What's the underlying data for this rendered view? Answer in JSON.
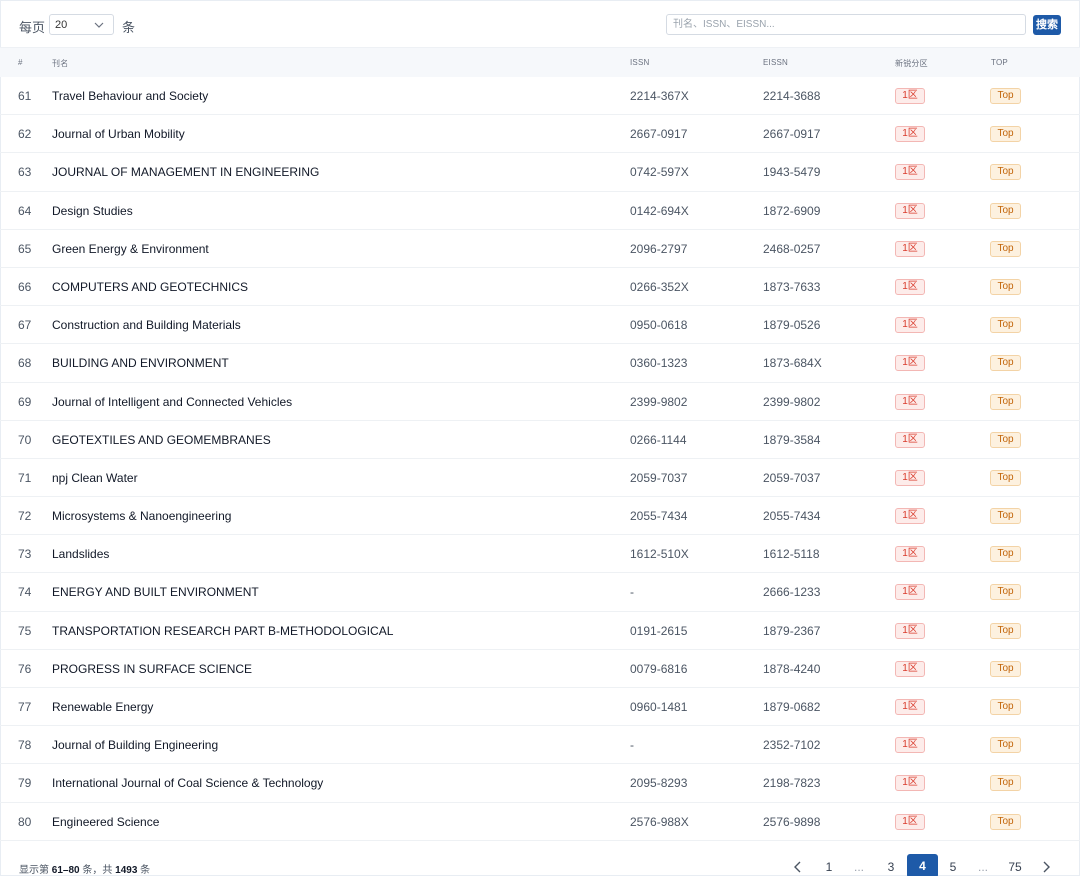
{
  "toolbar": {
    "per_page_label": "每页",
    "per_page_value": "20",
    "per_page_unit": "条",
    "search_placeholder": "刊名、ISSN、EISSN...",
    "search_button": "搜索"
  },
  "table": {
    "headers": [
      "#",
      "刊名",
      "ISSN",
      "EISSN",
      "新锐分区",
      "TOP"
    ],
    "rows": [
      {
        "num": "61",
        "name": "Travel Behaviour and Society",
        "issn": "2214-367X",
        "eissn": "2214-3688",
        "zone": "1区",
        "top": "Top"
      },
      {
        "num": "62",
        "name": "Journal of Urban Mobility",
        "issn": "2667-0917",
        "eissn": "2667-0917",
        "zone": "1区",
        "top": "Top"
      },
      {
        "num": "63",
        "name": "JOURNAL OF MANAGEMENT IN ENGINEERING",
        "issn": "0742-597X",
        "eissn": "1943-5479",
        "zone": "1区",
        "top": "Top"
      },
      {
        "num": "64",
        "name": "Design Studies",
        "issn": "0142-694X",
        "eissn": "1872-6909",
        "zone": "1区",
        "top": "Top"
      },
      {
        "num": "65",
        "name": "Green Energy & Environment",
        "issn": "2096-2797",
        "eissn": "2468-0257",
        "zone": "1区",
        "top": "Top"
      },
      {
        "num": "66",
        "name": "COMPUTERS AND GEOTECHNICS",
        "issn": "0266-352X",
        "eissn": "1873-7633",
        "zone": "1区",
        "top": "Top"
      },
      {
        "num": "67",
        "name": "Construction and Building Materials",
        "issn": "0950-0618",
        "eissn": "1879-0526",
        "zone": "1区",
        "top": "Top"
      },
      {
        "num": "68",
        "name": "BUILDING AND ENVIRONMENT",
        "issn": "0360-1323",
        "eissn": "1873-684X",
        "zone": "1区",
        "top": "Top"
      },
      {
        "num": "69",
        "name": "Journal of Intelligent and Connected Vehicles",
        "issn": "2399-9802",
        "eissn": "2399-9802",
        "zone": "1区",
        "top": "Top"
      },
      {
        "num": "70",
        "name": "GEOTEXTILES AND GEOMEMBRANES",
        "issn": "0266-1144",
        "eissn": "1879-3584",
        "zone": "1区",
        "top": "Top"
      },
      {
        "num": "71",
        "name": "npj Clean Water",
        "issn": "2059-7037",
        "eissn": "2059-7037",
        "zone": "1区",
        "top": "Top"
      },
      {
        "num": "72",
        "name": "Microsystems & Nanoengineering",
        "issn": "2055-7434",
        "eissn": "2055-7434",
        "zone": "1区",
        "top": "Top"
      },
      {
        "num": "73",
        "name": "Landslides",
        "issn": "1612-510X",
        "eissn": "1612-5118",
        "zone": "1区",
        "top": "Top"
      },
      {
        "num": "74",
        "name": "ENERGY AND BUILT ENVIRONMENT",
        "issn": "-",
        "eissn": "2666-1233",
        "zone": "1区",
        "top": "Top"
      },
      {
        "num": "75",
        "name": "TRANSPORTATION RESEARCH PART B-METHODOLOGICAL",
        "issn": "0191-2615",
        "eissn": "1879-2367",
        "zone": "1区",
        "top": "Top"
      },
      {
        "num": "76",
        "name": "PROGRESS IN SURFACE SCIENCE",
        "issn": "0079-6816",
        "eissn": "1878-4240",
        "zone": "1区",
        "top": "Top"
      },
      {
        "num": "77",
        "name": "Renewable Energy",
        "issn": "0960-1481",
        "eissn": "1879-0682",
        "zone": "1区",
        "top": "Top"
      },
      {
        "num": "78",
        "name": "Journal of Building Engineering",
        "issn": "-",
        "eissn": "2352-7102",
        "zone": "1区",
        "top": "Top"
      },
      {
        "num": "79",
        "name": "International Journal of Coal Science & Technology",
        "issn": "2095-8293",
        "eissn": "2198-7823",
        "zone": "1区",
        "top": "Top"
      },
      {
        "num": "80",
        "name": "Engineered Science",
        "issn": "2576-988X",
        "eissn": "2576-9898",
        "zone": "1区",
        "top": "Top"
      }
    ]
  },
  "footer": {
    "summary_prefix": "显示第 ",
    "range": "61–80",
    "summary_mid": " 条，共 ",
    "total": "1493",
    "summary_suffix": " 条",
    "pages": [
      "1",
      "...",
      "3",
      "4",
      "5",
      "...",
      "75"
    ],
    "current_page": "4"
  },
  "colors": {
    "primary": "#1e5aa8",
    "zone_text": "#d93a2b",
    "top_text": "#c2650a"
  }
}
